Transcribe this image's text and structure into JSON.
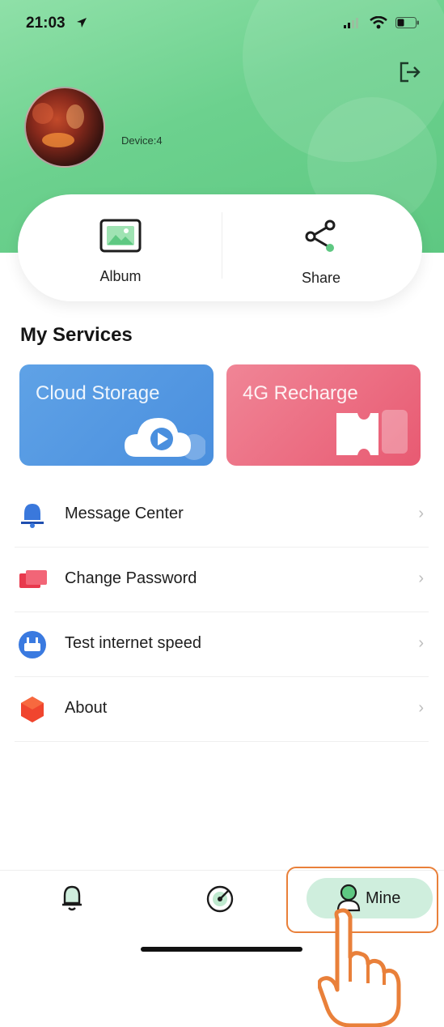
{
  "status_bar": {
    "time": "21:03"
  },
  "profile": {
    "device_label": "Device:4"
  },
  "quick_actions": [
    {
      "label": "Album",
      "icon": "album-icon"
    },
    {
      "label": "Share",
      "icon": "share-icon"
    }
  ],
  "services": {
    "title": "My Services",
    "cards": [
      {
        "label": "Cloud Storage",
        "color": "#4f95e0"
      },
      {
        "label": "4G Recharge",
        "color": "#ea6379"
      }
    ]
  },
  "menu": [
    {
      "label": "Message Center",
      "icon": "bell-icon",
      "color": "#2f6fd6"
    },
    {
      "label": "Change Password",
      "icon": "card-icon",
      "color": "#e83a4e"
    },
    {
      "label": "Test internet speed",
      "icon": "speed-icon",
      "color": "#3a7ae0"
    },
    {
      "label": "About",
      "icon": "hexagon-icon",
      "color": "#f0452e"
    }
  ],
  "tabbar": {
    "tabs": [
      {
        "icon": "bell-outline-icon"
      },
      {
        "icon": "radar-icon"
      },
      {
        "icon": "person-icon",
        "label": "Mine",
        "active": true
      }
    ],
    "active_color": "#cfeedd"
  },
  "accent_color": "#5ec882",
  "highlight_color": "#e9803a"
}
